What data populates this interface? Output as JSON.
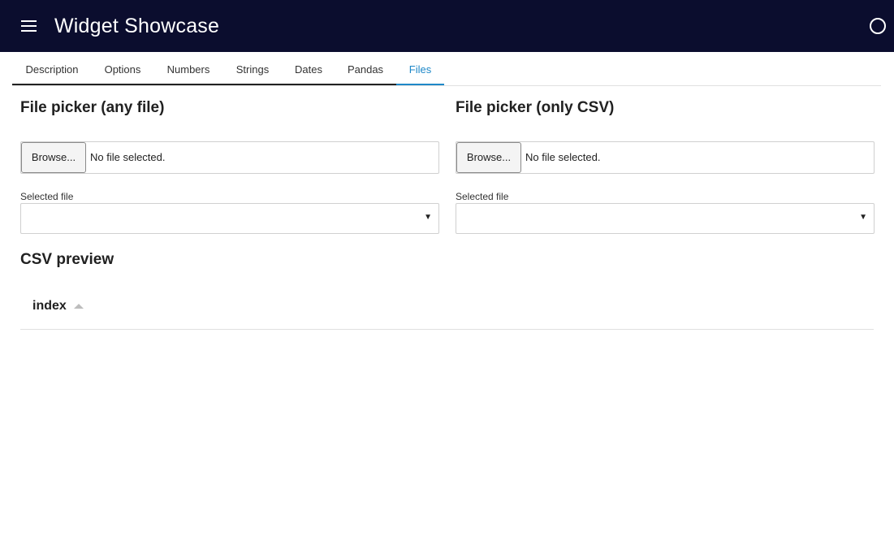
{
  "header": {
    "title": "Widget Showcase",
    "menu_icon": "hamburger-menu-icon",
    "status_icon": "busy-indicator-circle-icon",
    "background_color": "#0b0d2e"
  },
  "tabs": [
    {
      "label": "Description",
      "active": false
    },
    {
      "label": "Options",
      "active": false
    },
    {
      "label": "Numbers",
      "active": false
    },
    {
      "label": "Strings",
      "active": false
    },
    {
      "label": "Dates",
      "active": false
    },
    {
      "label": "Pandas",
      "active": false
    },
    {
      "label": "Files",
      "active": true
    }
  ],
  "accent_color": "#1e88c8",
  "file_picker_any": {
    "title": "File picker (any file)",
    "browse_label": "Browse...",
    "status": "No file selected.",
    "select_label": "Selected file",
    "select_value": ""
  },
  "file_picker_csv": {
    "title": "File picker (only CSV)",
    "browse_label": "Browse...",
    "status": "No file selected.",
    "select_label": "Selected file",
    "select_value": ""
  },
  "csv_preview": {
    "title": "CSV preview",
    "columns": [
      "index"
    ]
  }
}
